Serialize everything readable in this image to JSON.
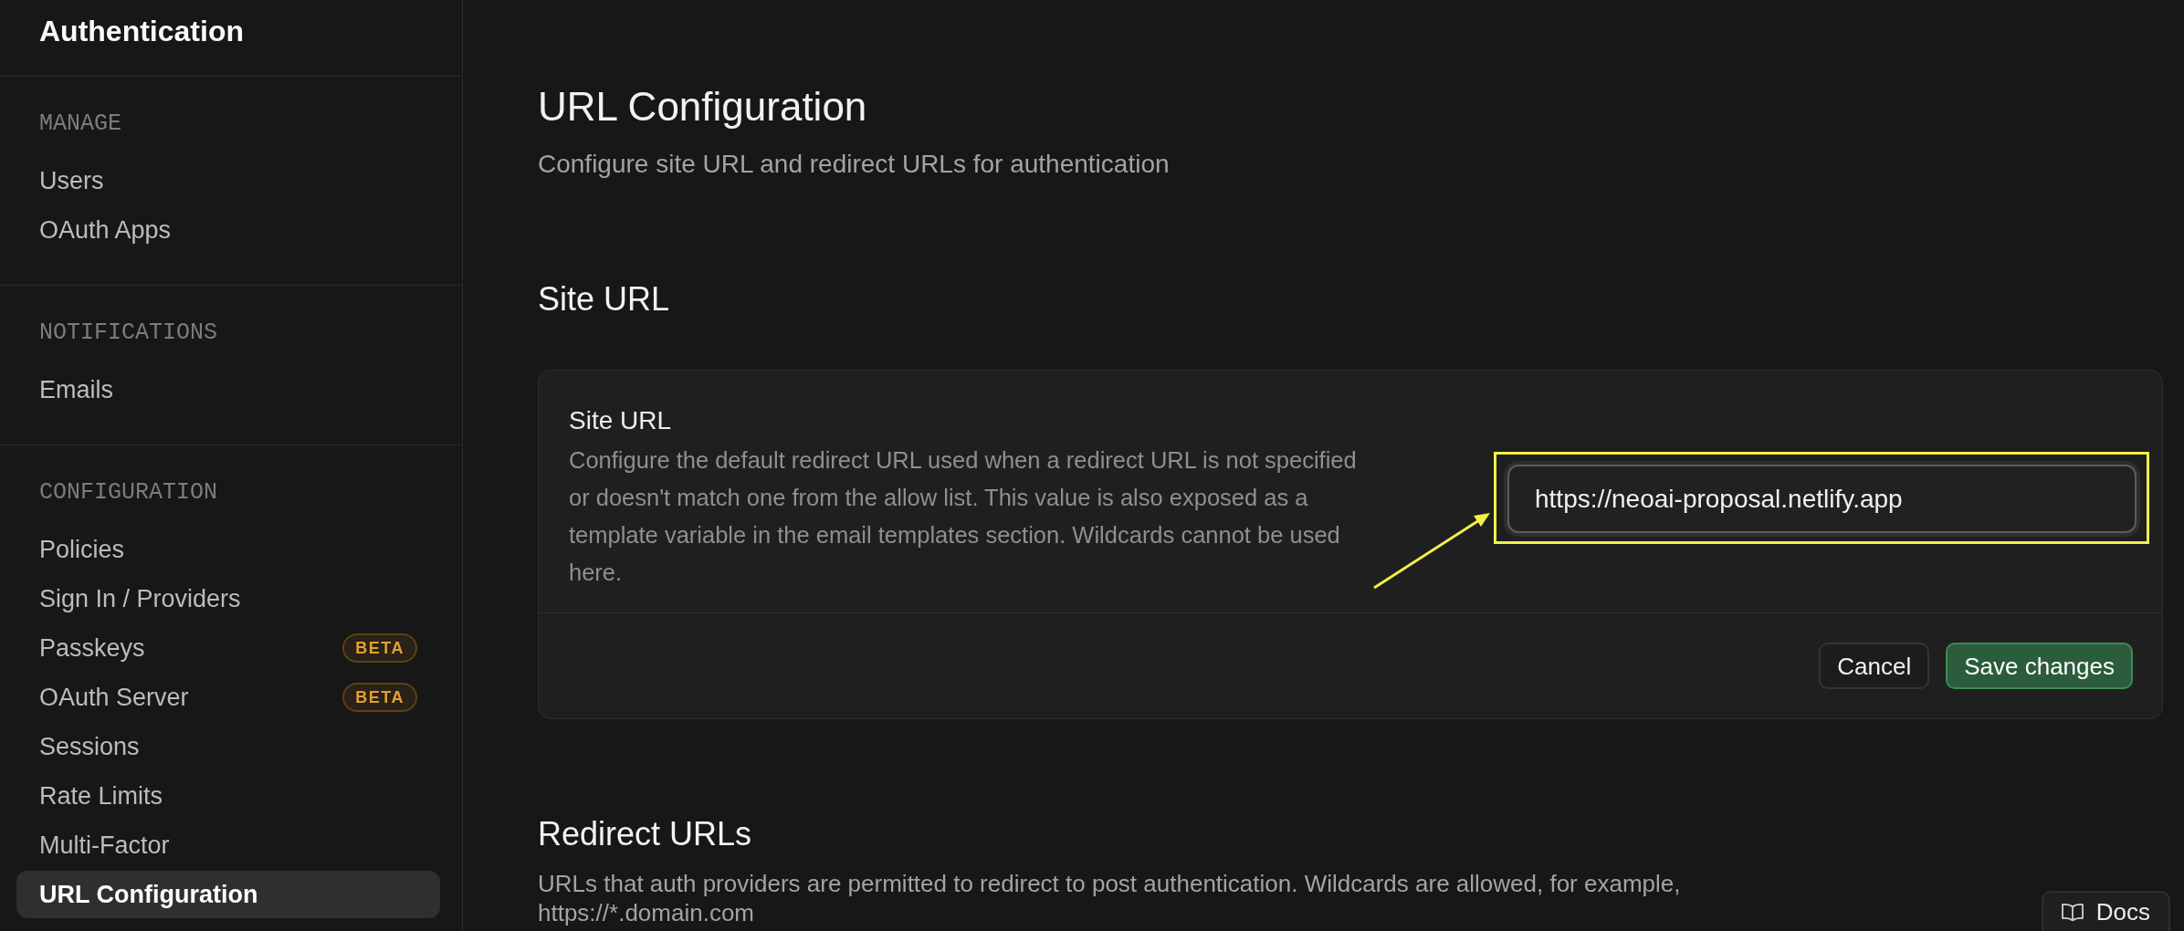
{
  "sidebar": {
    "title": "Authentication",
    "sections": [
      {
        "label": "MANAGE",
        "items": [
          {
            "label": "Users",
            "selected": false
          },
          {
            "label": "OAuth Apps",
            "selected": false
          }
        ]
      },
      {
        "label": "NOTIFICATIONS",
        "items": [
          {
            "label": "Emails",
            "selected": false
          }
        ]
      },
      {
        "label": "CONFIGURATION",
        "items": [
          {
            "label": "Policies",
            "selected": false
          },
          {
            "label": "Sign In / Providers",
            "selected": false
          },
          {
            "label": "Passkeys",
            "selected": false,
            "badge": "BETA"
          },
          {
            "label": "OAuth Server",
            "selected": false,
            "badge": "BETA"
          },
          {
            "label": "Sessions",
            "selected": false
          },
          {
            "label": "Rate Limits",
            "selected": false
          },
          {
            "label": "Multi-Factor",
            "selected": false
          },
          {
            "label": "URL Configuration",
            "selected": true
          }
        ]
      }
    ]
  },
  "page": {
    "title": "URL Configuration",
    "subtitle": "Configure site URL and redirect URLs for authentication"
  },
  "site_url": {
    "heading": "Site URL",
    "card": {
      "label": "Site URL",
      "description": "Configure the default redirect URL used when a redirect URL is not specified or doesn't match one from the allow list. This value is also exposed as a template variable in the email templates section. Wildcards cannot be used here.",
      "field": {
        "value": "https://neoai-proposal.netlify.app",
        "highlighted": true
      },
      "buttons": [
        {
          "label": "Cancel",
          "kind": "secondary"
        },
        {
          "label": "Save changes",
          "kind": "primary"
        }
      ]
    }
  },
  "redirect_urls": {
    "heading": "Redirect URLs",
    "description": "URLs that auth providers are permitted to redirect to post authentication. Wildcards are allowed, for example, https://*.domain.com"
  },
  "docs_button": {
    "label": "Docs"
  }
}
